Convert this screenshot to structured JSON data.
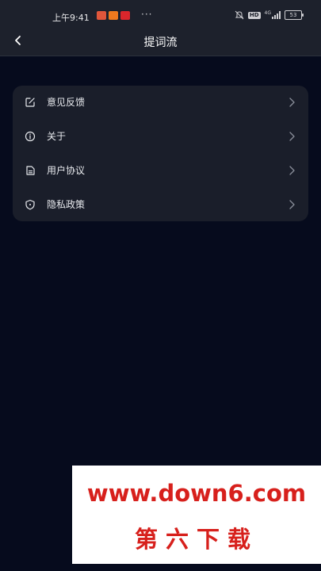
{
  "status_bar": {
    "time": "上午9:41",
    "more": "···",
    "network": "4G",
    "hd": "HD",
    "battery": "53"
  },
  "header": {
    "title": "提词流"
  },
  "menu": {
    "items": [
      {
        "label": "意见反馈",
        "icon": "feedback-edit-icon"
      },
      {
        "label": "关于",
        "icon": "info-icon"
      },
      {
        "label": "用户协议",
        "icon": "document-icon"
      },
      {
        "label": "隐私政策",
        "icon": "shield-icon"
      }
    ]
  },
  "watermark": {
    "url": "www.down6.com",
    "name": "第六下载"
  },
  "colors": {
    "background": "#060b1d",
    "header": "#1d212c",
    "card": "#1a1e2a",
    "watermark_red": "#d7201c"
  }
}
